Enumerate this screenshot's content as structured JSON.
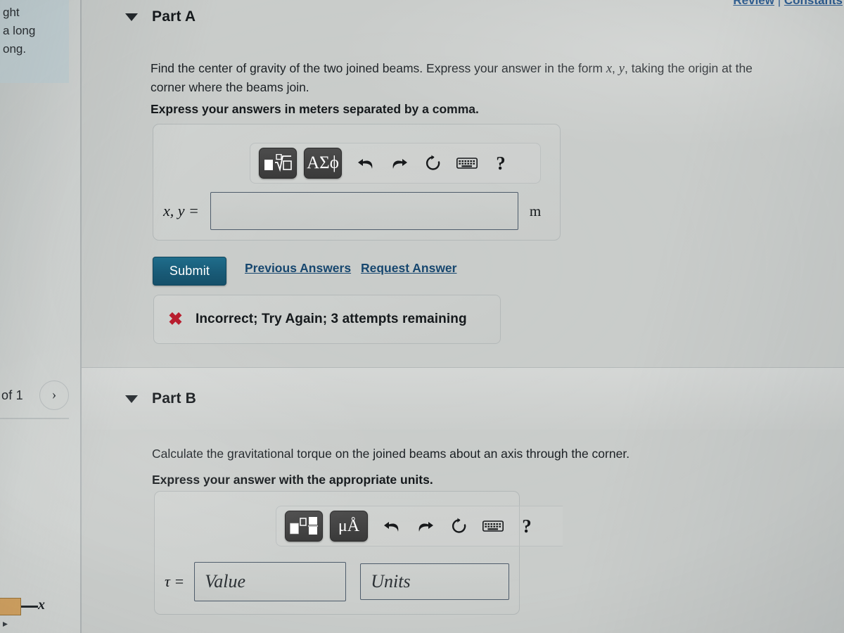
{
  "topbar": {
    "review_link": "Review",
    "separator": "|",
    "constants_link": "Constants"
  },
  "sidebar": {
    "note_lines": [
      "ght",
      "a long",
      "ong."
    ],
    "pagination": {
      "of_label": "of 1",
      "next_icon": "›"
    },
    "figure": {
      "axis_label": "x"
    }
  },
  "part_a": {
    "title": "Part A",
    "caret_icon": "caret-down-icon",
    "question_line1_pre": "Find the center of gravity of the two joined beams. Express your answer in the form ",
    "question_var_x": "x",
    "question_comma": ", ",
    "question_var_y": "y",
    "question_line1_post": ", taking the origin at the",
    "question_line2": "corner where the beams join.",
    "instruction": "Express your answers in meters separated by a comma.",
    "toolbar": {
      "template_button": "template-icon",
      "greek_button": "ΑΣϕ",
      "undo": "undo-icon",
      "redo": "redo-icon",
      "reset": "reset-icon",
      "keyboard": "keyboard-icon",
      "help": "?"
    },
    "answer": {
      "label": "x, y =",
      "value": "",
      "placeholder": "",
      "unit": "m"
    },
    "submit_label": "Submit",
    "previous_answers_label": "Previous Answers",
    "request_answer_label": "Request Answer",
    "feedback": {
      "icon": "✖",
      "icon_color": "#b81d2e",
      "message": "Incorrect; Try Again; 3 attempts remaining"
    }
  },
  "part_b": {
    "title": "Part B",
    "caret_icon": "caret-down-icon",
    "question": "Calculate the gravitational torque on the joined beams about an axis through the corner.",
    "instruction": "Express your answer with the appropriate units.",
    "toolbar": {
      "template_button": "template-icon",
      "units_button": "μÅ",
      "undo": "undo-icon",
      "redo": "redo-icon",
      "reset": "reset-icon",
      "keyboard": "keyboard-icon",
      "help": "?"
    },
    "answer": {
      "label": "τ =",
      "value_placeholder": "Value",
      "units_placeholder": "Units"
    }
  },
  "colors": {
    "submit_button": "#185975",
    "link": "#17476f",
    "error": "#b81d2e",
    "page_background": "#c9ccca",
    "sidebar_note": "#c3d0d3",
    "input_border": "#4e5c6b"
  }
}
